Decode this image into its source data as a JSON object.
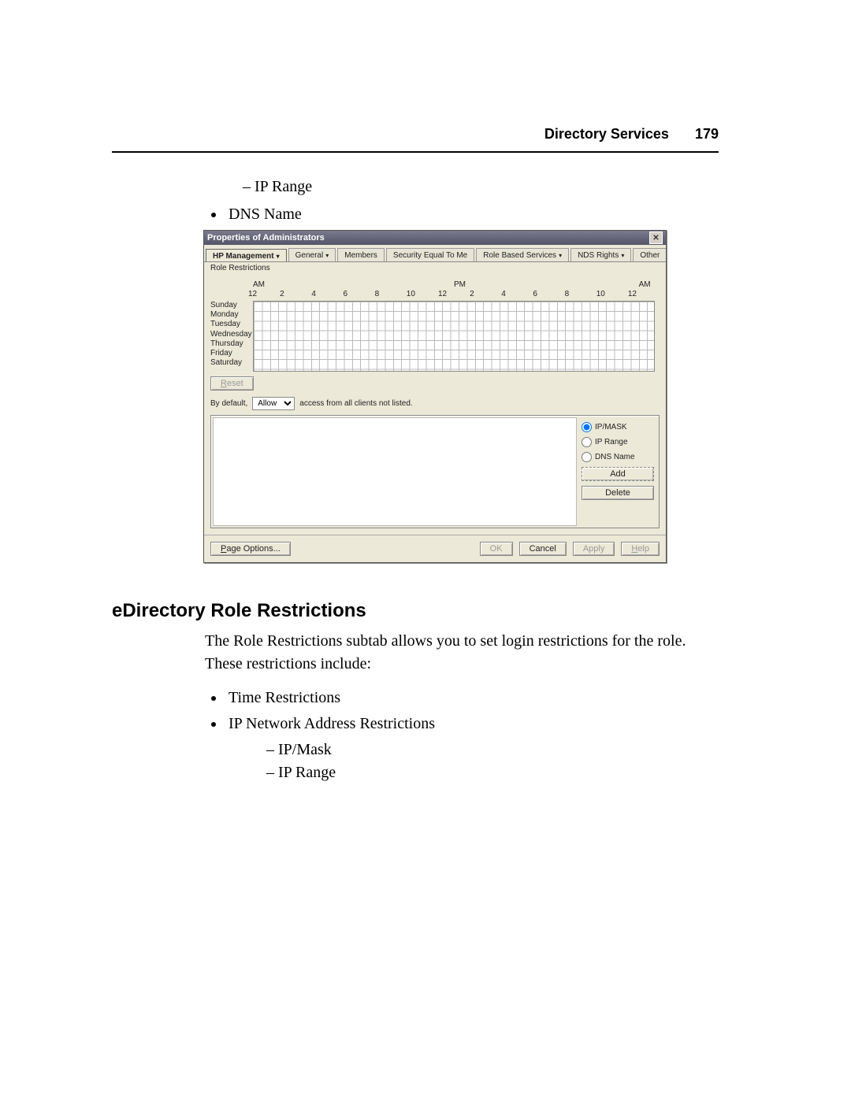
{
  "header": {
    "section": "Directory Services",
    "page_number": "179"
  },
  "pre_list": {
    "sub_items": [
      "IP Range"
    ],
    "bullets": [
      "DNS Name"
    ]
  },
  "dialog": {
    "title": "Properties of Administrators",
    "tabs": [
      "HP Management",
      "General",
      "Members",
      "Security Equal To Me",
      "Role Based Services",
      "NDS Rights",
      "Other"
    ],
    "active_tab_index": 0,
    "active_subtab": "Role Restrictions",
    "ampm": {
      "am": "AM",
      "pm": "PM",
      "am2": "AM"
    },
    "hours": [
      "12",
      "2",
      "4",
      "6",
      "8",
      "10",
      "12",
      "2",
      "4",
      "6",
      "8",
      "10",
      "12"
    ],
    "days": [
      "Sunday",
      "Monday",
      "Tuesday",
      "Wednesday",
      "Thursday",
      "Friday",
      "Saturday"
    ],
    "reset_label": "Reset",
    "bydefault_prefix": "By default,",
    "bydefault_select": "Allow",
    "bydefault_suffix": "access from all clients not listed.",
    "radio_options": [
      "IP/MASK",
      "IP Range",
      "DNS Name"
    ],
    "radio_selected_index": 0,
    "add_label": "Add",
    "delete_label": "Delete",
    "footer": {
      "page_options": "Page Options...",
      "ok": "OK",
      "cancel": "Cancel",
      "apply": "Apply",
      "help": "Help"
    }
  },
  "section2": {
    "heading": "eDirectory Role Restrictions",
    "para": "The Role Restrictions subtab allows you to set login restrictions for the role. These restrictions include:",
    "bullets": [
      {
        "text": "Time Restrictions",
        "sub": []
      },
      {
        "text": "IP Network Address Restrictions",
        "sub": [
          "IP/Mask",
          "IP Range"
        ]
      }
    ]
  }
}
